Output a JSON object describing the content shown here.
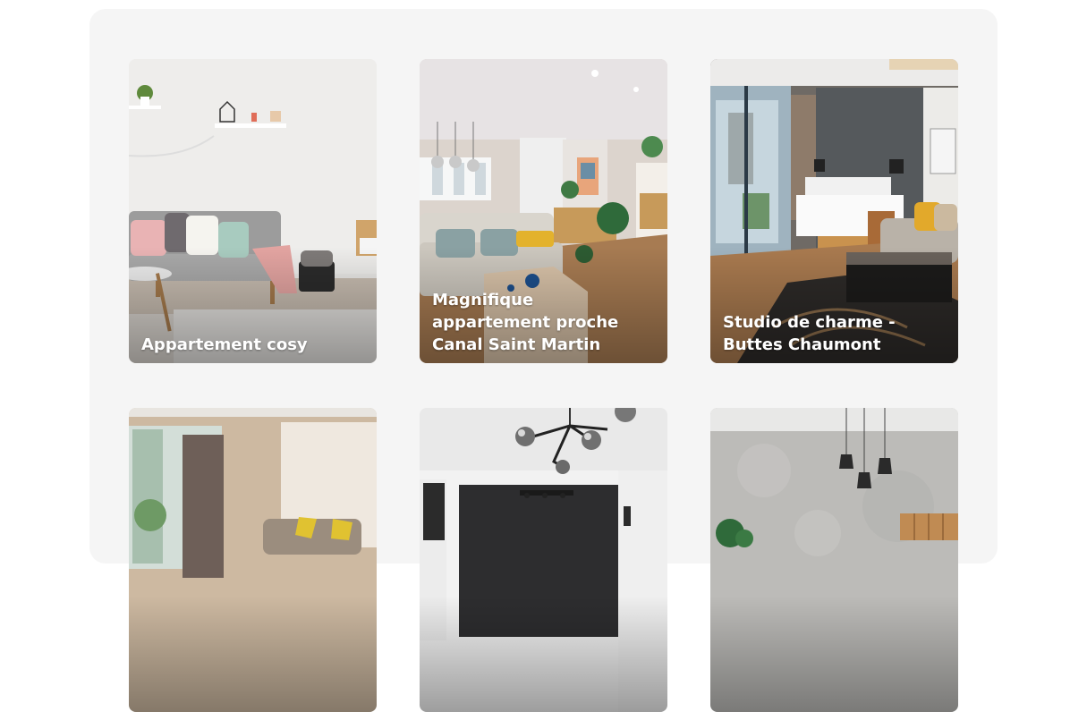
{
  "listings": [
    {
      "title": "Appartement cosy",
      "photo": "living-room-grey-sofa-photo"
    },
    {
      "title": "Magnifique appartement proche Canal Saint Martin",
      "photo": "living-room-pendant-lights-photo"
    },
    {
      "title": "Studio de charme - Buttes Chaumont",
      "photo": "hotel-bedroom-photo"
    },
    {
      "title": "",
      "photo": "bright-room-large-window-photo"
    },
    {
      "title": "",
      "photo": "kitchen-globe-chandelier-photo"
    },
    {
      "title": "",
      "photo": "concrete-wall-pendant-lights-photo"
    }
  ],
  "colors": {
    "panel_background": "#f5f5f5",
    "page_background": "#ffffff",
    "title_text": "#ffffff"
  }
}
